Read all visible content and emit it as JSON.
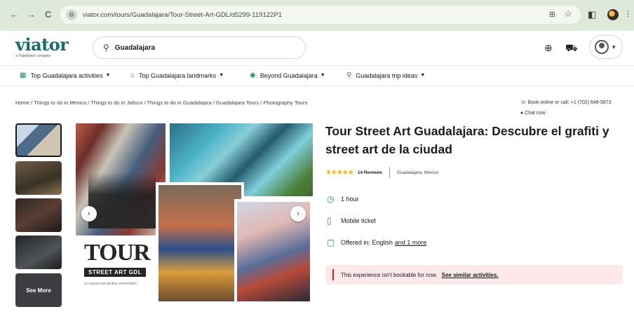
{
  "browser": {
    "back": "←",
    "forward": "→",
    "reload": "C",
    "url": "viator.com/tours/Guadalajara/Tour-Street-Art-GDL/d5299-119122P1"
  },
  "header": {
    "logo": "viator",
    "logo_sub": "a Tripadvisor company",
    "search_value": "Guadalajara"
  },
  "nav": {
    "items": [
      {
        "label": "Top Guadalajara activities",
        "icon": "calendar-icon"
      },
      {
        "label": "Top Guadalajara landmarks",
        "icon": "landmark-icon"
      },
      {
        "label": "Beyond Guadalajara",
        "icon": "globe-icon"
      },
      {
        "label": "Guadalajara trip ideas",
        "icon": "pin-icon"
      }
    ]
  },
  "breadcrumb": "Home / Things to do in Mexico / Things to do in Jalisco / Things to do in Guadalajara / Guadalajara Tours / Photography Tours",
  "contact": {
    "line1": "Book online or call: +1 (702) 648-5873",
    "line2": "Chat now"
  },
  "gallery": {
    "see_more": "See More",
    "brand_big": "TOUR",
    "brand_bar": "STREET ART GDL",
    "brand_tiny": "LA COLECTIVA MURAL GRAFITERA"
  },
  "product": {
    "title": "Tour Street Art Guadalajara: Descubre el grafiti y street art de la ciudad",
    "stars": "★★★★★",
    "rating": 5,
    "reviews": "14 Reviews",
    "location": "Guadalajara, Mexico",
    "features": [
      {
        "icon": "clock-icon",
        "label": "1 hour"
      },
      {
        "icon": "phone-icon",
        "label": "Mobile ticket"
      },
      {
        "icon": "chat-icon",
        "label": "Offered in: English",
        "link": "and 1 more"
      }
    ]
  },
  "banner": {
    "message": "This experience isn't bookable for now.",
    "link": "See similar activities."
  },
  "colors": {
    "brand": "#186b6d",
    "accent": "#1e8a67",
    "star": "#ffb400",
    "alert": "#d3202f",
    "alert_bg": "#fde8ea"
  }
}
